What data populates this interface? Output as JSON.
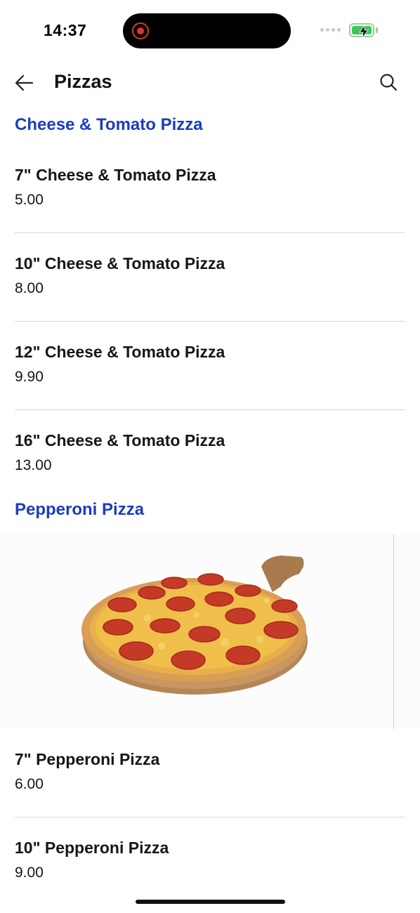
{
  "status_bar": {
    "time": "14:37"
  },
  "header": {
    "title": "Pizzas"
  },
  "sections": [
    {
      "heading": "Cheese & Tomato Pizza",
      "items": [
        {
          "name": "7\" Cheese & Tomato Pizza",
          "price": "5.00"
        },
        {
          "name": "10\" Cheese & Tomato Pizza",
          "price": "8.00"
        },
        {
          "name": "12\" Cheese & Tomato Pizza",
          "price": "9.90"
        },
        {
          "name": "16\" Cheese & Tomato Pizza",
          "price": "13.00"
        }
      ]
    },
    {
      "heading": "Pepperoni Pizza",
      "items": [
        {
          "name": "7\" Pepperoni Pizza",
          "price": "6.00"
        },
        {
          "name": "10\" Pepperoni Pizza",
          "price": "9.00"
        }
      ]
    }
  ],
  "colors": {
    "section_heading": "#1c3dbb",
    "divider": "#d8d8d8",
    "recording": "#e0352c",
    "battery": "#3cc75a"
  },
  "icons": {
    "back": "arrow-left-icon",
    "search": "search-icon",
    "recording": "recording-icon",
    "battery": "battery-charging-icon",
    "signal": "signal-icon"
  }
}
